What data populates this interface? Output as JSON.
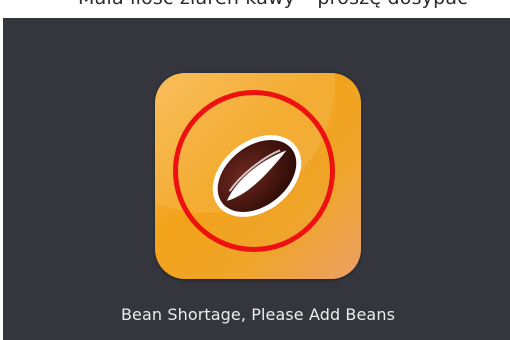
{
  "header": {
    "banner_text": "Mała ilość ziaren kawy – proszę dosypać"
  },
  "dialog": {
    "icon_name": "coffee-bean-icon",
    "message": "Bean Shortage, Please Add Beans"
  },
  "colors": {
    "panel_background": "#34353d",
    "tile_orange": "#f3a31a",
    "warning_ring": "#ee1111",
    "bean_brown": "#4a1812",
    "message_text": "#ececec"
  }
}
